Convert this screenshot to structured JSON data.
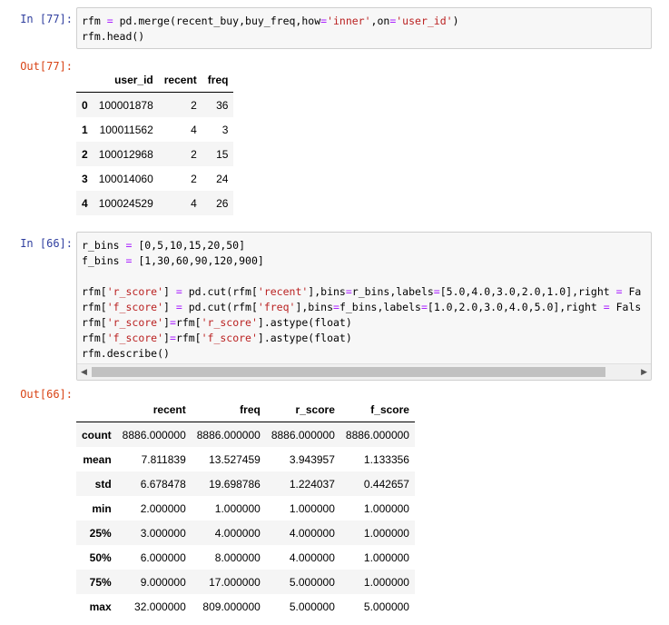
{
  "cells": [
    {
      "in_prompt": "In  [77]:",
      "out_prompt": "Out[77]:",
      "code_lines": [
        "rfm = pd.merge(recent_buy,buy_freq,how='inner',on='user_id')",
        "rfm.head()"
      ],
      "table": {
        "columns": [
          "user_id",
          "recent",
          "freq"
        ],
        "rows": [
          [
            "0",
            "100001878",
            "2",
            "36"
          ],
          [
            "1",
            "100011562",
            "4",
            "3"
          ],
          [
            "2",
            "100012968",
            "2",
            "15"
          ],
          [
            "3",
            "100014060",
            "2",
            "24"
          ],
          [
            "4",
            "100024529",
            "4",
            "26"
          ]
        ]
      }
    },
    {
      "in_prompt": "In  [66]:",
      "out_prompt": "Out[66]:",
      "code_lines": [
        "r_bins = [0,5,10,15,20,50]",
        "f_bins = [1,30,60,90,120,900]",
        "",
        "rfm['r_score'] = pd.cut(rfm['recent'],bins=r_bins,labels=[5.0,4.0,3.0,2.0,1.0],right = Fa",
        "rfm['f_score'] = pd.cut(rfm['freq'],bins=f_bins,labels=[1.0,2.0,3.0,4.0,5.0],right = Fals",
        "rfm['r_score']=rfm['r_score'].astype(float)",
        "rfm['f_score']=rfm['f_score'].astype(float)",
        "rfm.describe()"
      ],
      "table": {
        "columns": [
          "recent",
          "freq",
          "r_score",
          "f_score"
        ],
        "rows": [
          [
            "count",
            "8886.000000",
            "8886.000000",
            "8886.000000",
            "8886.000000"
          ],
          [
            "mean",
            "7.811839",
            "13.527459",
            "3.943957",
            "1.133356"
          ],
          [
            "std",
            "6.678478",
            "19.698786",
            "1.224037",
            "0.442657"
          ],
          [
            "min",
            "2.000000",
            "1.000000",
            "1.000000",
            "1.000000"
          ],
          [
            "25%",
            "3.000000",
            "4.000000",
            "4.000000",
            "1.000000"
          ],
          [
            "50%",
            "6.000000",
            "8.000000",
            "4.000000",
            "1.000000"
          ],
          [
            "75%",
            "9.000000",
            "17.000000",
            "5.000000",
            "1.000000"
          ],
          [
            "max",
            "32.000000",
            "809.000000",
            "5.000000",
            "5.000000"
          ]
        ]
      }
    }
  ],
  "scrollbar": {
    "left_arrow": "◀",
    "right_arrow": "▶"
  }
}
